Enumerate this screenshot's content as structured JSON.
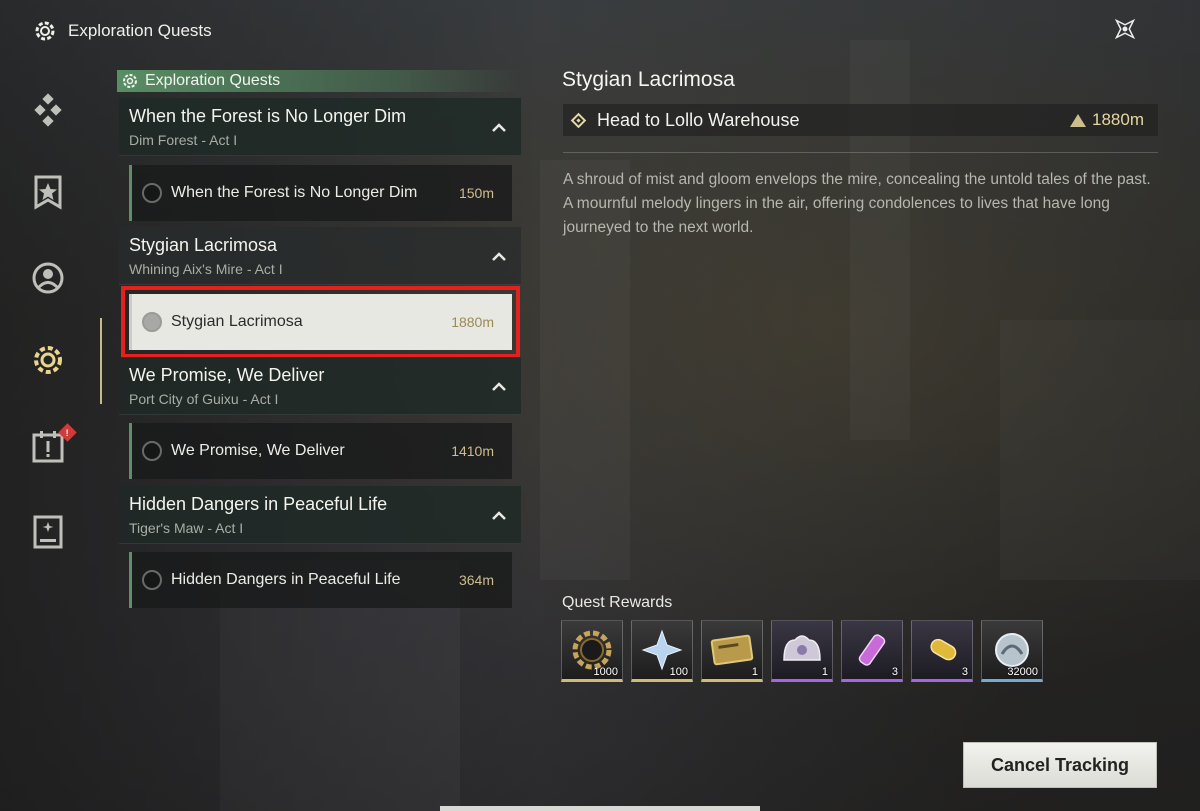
{
  "header": {
    "title": "Exploration Quests",
    "icon": "gear-icon"
  },
  "close": {
    "icon": "close-icon"
  },
  "rail": {
    "items": [
      {
        "icon": "diamond-cluster-icon"
      },
      {
        "icon": "star-banner-icon"
      },
      {
        "icon": "person-circle-icon"
      },
      {
        "icon": "gear-icon",
        "active": true
      },
      {
        "icon": "calendar-alert-icon",
        "badge": "!"
      },
      {
        "icon": "book-icon"
      }
    ]
  },
  "list": {
    "header": "Exploration Quests",
    "groups": [
      {
        "title": "When the Forest is No Longer Dim",
        "subtitle": "Dim Forest - Act I",
        "entry": {
          "title": "When the Forest is No Longer Dim",
          "distance": "150m"
        }
      },
      {
        "title": "Stygian Lacrimosa",
        "subtitle": "Whining Aix's Mire - Act I",
        "entry": {
          "title": "Stygian Lacrimosa",
          "distance": "1880m",
          "selected": true
        }
      },
      {
        "title": "We Promise, We Deliver",
        "subtitle": "Port City of Guixu - Act I",
        "entry": {
          "title": "We Promise, We Deliver",
          "distance": "1410m"
        }
      },
      {
        "title": "Hidden Dangers in Peaceful Life",
        "subtitle": "Tiger's Maw - Act I",
        "entry": {
          "title": "Hidden Dangers in Peaceful Life",
          "distance": "364m"
        }
      }
    ]
  },
  "detail": {
    "title": "Stygian Lacrimosa",
    "objective": "Head to Lollo Warehouse",
    "objective_distance": "1880m",
    "description": "A shroud of mist and gloom envelops the mire, concealing the untold tales of the past. A mournful melody lingers in the air, offering condolences to lives that have long journeyed to the next world.",
    "rewards_label": "Quest Rewards",
    "rewards": [
      {
        "icon": "gear-coin-icon",
        "qty": "1000",
        "rarity": "gold"
      },
      {
        "icon": "crystal-star-icon",
        "qty": "100",
        "rarity": "gold"
      },
      {
        "icon": "ticket-icon",
        "qty": "1",
        "rarity": "gold"
      },
      {
        "icon": "ornament-crown-icon",
        "qty": "1",
        "rarity": "purple"
      },
      {
        "icon": "potion-vial-icon",
        "qty": "3",
        "rarity": "purple"
      },
      {
        "icon": "energy-capsule-icon",
        "qty": "3",
        "rarity": "purple"
      },
      {
        "icon": "shell-coin-icon",
        "qty": "32000",
        "rarity": "blue"
      }
    ]
  },
  "actions": {
    "cancel_label": "Cancel Tracking"
  },
  "colors": {
    "accent_green": "#60a06e",
    "selection_red": "#e5211d",
    "gold": "#cdbd8a"
  }
}
